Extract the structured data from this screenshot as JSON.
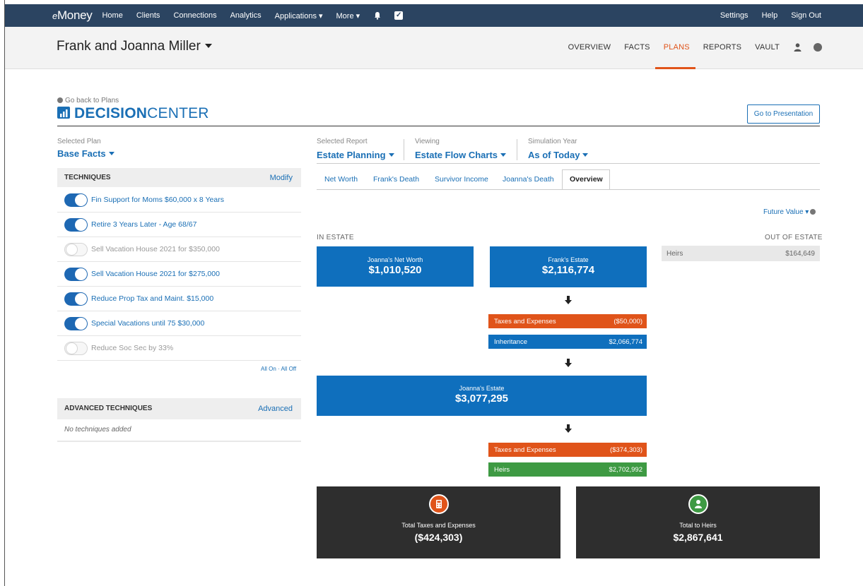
{
  "nav": {
    "logo_prefix": "e",
    "logo_suffix": "Money",
    "items": [
      "Home",
      "Clients",
      "Connections",
      "Analytics",
      "Applications ▾",
      "More ▾"
    ],
    "right_items": [
      "Settings",
      "Help",
      "Sign Out"
    ]
  },
  "client": {
    "name": "Frank and Joanna Miller",
    "tabs": [
      "OVERVIEW",
      "FACTS",
      "PLANS",
      "REPORTS",
      "VAULT"
    ],
    "active_tab": "PLANS"
  },
  "decision_center": {
    "back_link": "Go back to Plans",
    "title_bold": "DECISION",
    "title_rest": "CENTER",
    "presentation_button": "Go to Presentation"
  },
  "plan": {
    "label": "Selected Plan",
    "value": "Base Facts"
  },
  "techniques": {
    "header": "TECHNIQUES",
    "modify_link": "Modify",
    "items": [
      {
        "label": "Fin Support for Moms $60,000 x 8 Years",
        "on": true
      },
      {
        "label": "Retire 3 Years Later - Age 68/67",
        "on": true
      },
      {
        "label": "Sell Vacation House 2021 for $350,000",
        "on": false
      },
      {
        "label": "Sell Vacation House 2021 for $275,000",
        "on": true
      },
      {
        "label": "Reduce Prop Tax and Maint. $15,000",
        "on": true
      },
      {
        "label": "Special Vacations until 75 $30,000",
        "on": true
      },
      {
        "label": "Reduce Soc Sec by 33%",
        "on": false
      }
    ],
    "all_on_off": "All On · All Off"
  },
  "advanced": {
    "header": "ADVANCED TECHNIQUES",
    "link": "Advanced",
    "empty_text": "No techniques added"
  },
  "report": {
    "selected_report_label": "Selected Report",
    "selected_report": "Estate Planning",
    "viewing_label": "Viewing",
    "viewing": "Estate Flow Charts",
    "year_label": "Simulation Year",
    "year": "As of Today",
    "tabs": [
      "Net Worth",
      "Frank's Death",
      "Survivor Income",
      "Joanna's Death",
      "Overview"
    ],
    "active_tab": "Overview",
    "future_value": "Future Value ▾"
  },
  "flow": {
    "in_estate_label": "IN ESTATE",
    "out_of_estate_label": "OUT OF ESTATE",
    "heirs_out": {
      "label": "Heirs",
      "value": "$164,649"
    },
    "joanna_net_worth": {
      "label": "Joanna's Net Worth",
      "value": "$1,010,520"
    },
    "frank_estate": {
      "label": "Frank's Estate",
      "value": "$2,116,774"
    },
    "frank_taxes": {
      "label": "Taxes and Expenses",
      "value": "($50,000)"
    },
    "inheritance": {
      "label": "Inheritance",
      "value": "$2,066,774"
    },
    "joanna_estate": {
      "label": "Joanna's Estate",
      "value": "$3,077,295"
    },
    "joanna_taxes": {
      "label": "Taxes and Expenses",
      "value": "($374,303)"
    },
    "heirs": {
      "label": "Heirs",
      "value": "$2,702,992"
    },
    "total_taxes": {
      "label": "Total Taxes and Expenses",
      "value": "($424,303)"
    },
    "total_heirs": {
      "label": "Total to Heirs",
      "value": "$2,867,641"
    }
  },
  "colors": {
    "nav_bg": "#2b4461",
    "accent_blue": "#0f6fbd",
    "accent_orange": "#e0541a",
    "heirs_green": "#3e9a43",
    "summary_dark": "#2e2e2e"
  }
}
